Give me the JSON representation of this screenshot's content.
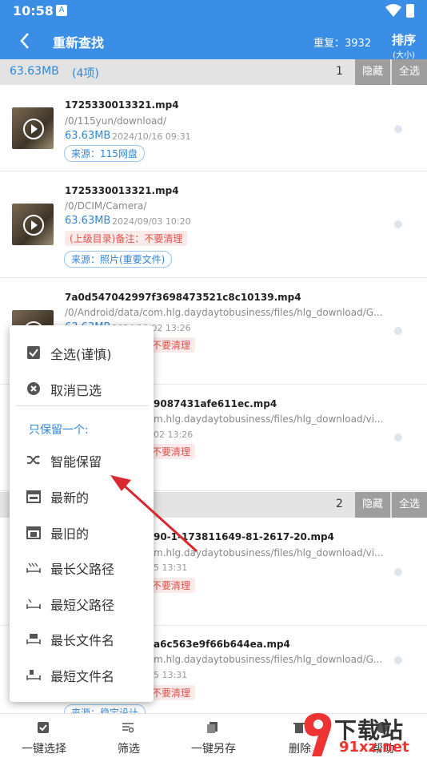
{
  "status": {
    "time": "10:58",
    "notif_icon": "A"
  },
  "appbar": {
    "title": "重新查找",
    "dup_label": "重复：3932",
    "sort_label": "排序",
    "sort_sub": "(大小)"
  },
  "group1": {
    "size": "63.63MB",
    "count": "(4项)",
    "index": "1",
    "hide": "隐藏",
    "select_all": "全选"
  },
  "group2": {
    "index": "2",
    "hide": "隐藏",
    "select_all": "全选"
  },
  "items": [
    {
      "name": "1725330013321.mp4",
      "path": "/0/115yun/download/",
      "size": "63.63MB",
      "date": "2024/10/16 09:31",
      "source": "来源：115网盘"
    },
    {
      "name": "1725330013321.mp4",
      "path": "/0/DCIM/Camera/",
      "size": "63.63MB",
      "date": "2024/09/03 10:20",
      "note": "(上级目录)备注：不要清理",
      "source": "来源：照片(重要文件)"
    },
    {
      "name": "7a0d547042997f3698473521c8c10139.mp4",
      "path": "/0/Android/data/com.hlg.daydaytobusiness/files/hlg_download/G...",
      "size": "63.63MB",
      "date": "2024/10/02 13:26",
      "note": "不要清理"
    },
    {
      "name": "9087431afe611ec.mp4",
      "path": "m.hlg.daydaytobusiness/files/hlg_download/vi...",
      "date": "02 13:26",
      "note": "不要清理"
    },
    {
      "name": "90-1-173811649-81-2617-20.mp4",
      "path": "m.hlg.daydaytobusiness/files/hlg_download/vi...",
      "date": "5 13:31",
      "note": "不要清理"
    },
    {
      "name": "a6c563e9f66b644ea.mp4",
      "path": "m.hlg.daydaytobusiness/files/hlg_download/G...",
      "date": "5 13:31",
      "note": "不要清理",
      "source": "来源：稳定设计"
    }
  ],
  "menu": {
    "select_all": "全选(谨慎)",
    "deselect": "取消已选",
    "section": "只保留一个:",
    "smart_keep": "智能保留",
    "newest": "最新的",
    "oldest": "最旧的",
    "longest_parent": "最长父路径",
    "shortest_parent": "最短父路径",
    "longest_name": "最长文件名",
    "shortest_name": "最短文件名"
  },
  "bottom": {
    "select_one": "一键选择",
    "filter": "筛选",
    "save_as": "一键另存",
    "delete": "删除",
    "help": "帮助"
  },
  "watermark": {
    "brand": "下载站",
    "url": "91xz.net"
  },
  "colors": {
    "primary": "#3a8ee6",
    "link": "#2d87d8",
    "warning": "#e0524a",
    "arrow": "#d9282f"
  }
}
